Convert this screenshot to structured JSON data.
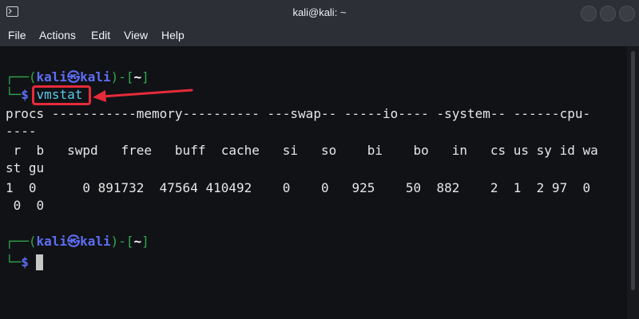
{
  "window": {
    "title": "kali@kali: ~"
  },
  "menu": {
    "items": [
      "File",
      "Actions",
      "Edit",
      "View",
      "Help"
    ]
  },
  "prompt1": {
    "corner_top": "┌──(",
    "user": "kali",
    "at": "㉿",
    "host": "kali",
    "mid": ")-[",
    "dir": "~",
    "end": "]",
    "corner_bottom": "└─",
    "dollar": "$",
    "command": "vmstat"
  },
  "output": {
    "header1": "procs -----------memory---------- ---swap-- -----io---- -system-- ------cpu-",
    "header1_wrap": "----",
    "header2": " r  b   swpd   free   buff  cache   si   so    bi    bo   in   cs us sy id wa",
    "header2_wrap": "st gu",
    "values": "1  0      0 891732  47564 410492    0    0   925    50  882    2  1  2 97  0",
    "values_wrap": " 0  0"
  },
  "prompt2": {
    "corner_top": "┌──(",
    "user": "kali",
    "at": "㉿",
    "host": "kali",
    "mid": ")-[",
    "dir": "~",
    "end": "]",
    "corner_bottom": "└─",
    "dollar": "$"
  },
  "colors": {
    "prompt_green": "#2fa84f",
    "prompt_blue": "#5d6df2",
    "command_cyan": "#59c8e8",
    "highlight_red": "#e52b3a"
  }
}
